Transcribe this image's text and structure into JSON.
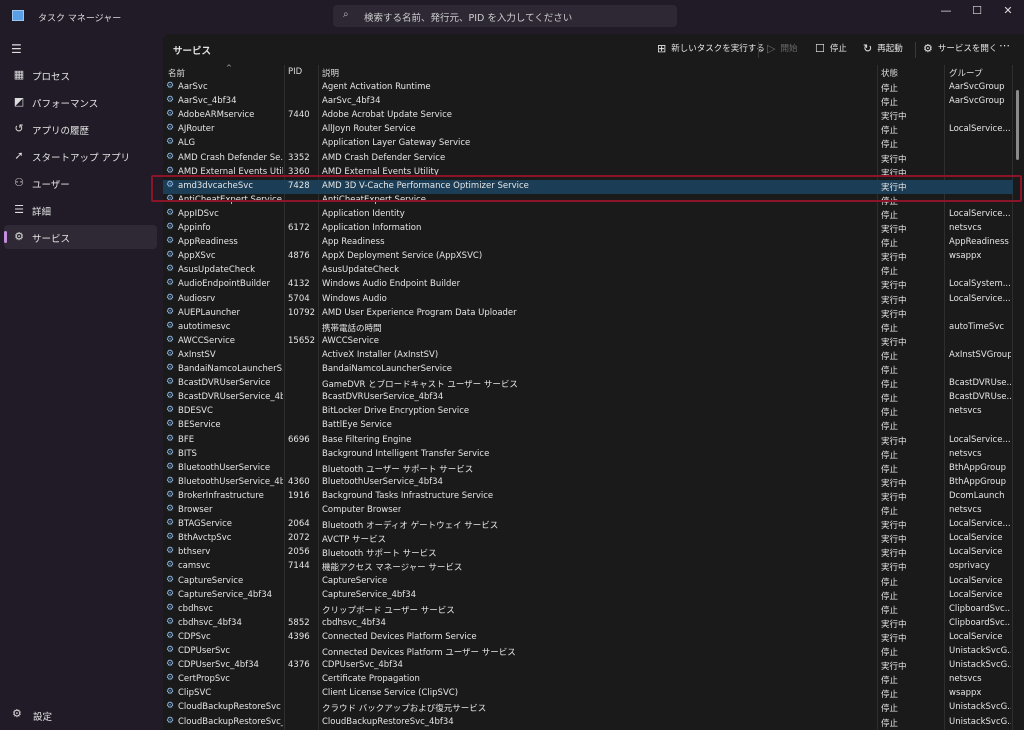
{
  "app": {
    "title": "タスク マネージャー",
    "search_placeholder": "検索する名前、発行元、PID を入力してください"
  },
  "sidebar": {
    "items": [
      {
        "label": "プロセス",
        "icon": "▦"
      },
      {
        "label": "パフォーマンス",
        "icon": "◩"
      },
      {
        "label": "アプリの履歴",
        "icon": "↺"
      },
      {
        "label": "スタートアップ アプリ",
        "icon": "➚"
      },
      {
        "label": "ユーザー",
        "icon": "⚇"
      },
      {
        "label": "詳細",
        "icon": "☰"
      },
      {
        "label": "サービス",
        "icon": "⚙"
      }
    ],
    "settings": "設定"
  },
  "toolbar": {
    "title": "サービス",
    "run_new_task": "新しいタスクを実行する",
    "start": "開始",
    "stop": "停止",
    "restart": "再起動",
    "open_services": "サービスを開く",
    "more": "⋯"
  },
  "columns": {
    "name": "名前",
    "pid": "PID",
    "description": "説明",
    "status": "状態",
    "group": "グループ"
  },
  "selected_index": 7,
  "accent": "#8b1428",
  "rows": [
    [
      "AarSvc",
      "",
      "Agent Activation Runtime",
      "停止",
      "AarSvcGroup"
    ],
    [
      "AarSvc_4bf34",
      "",
      "AarSvc_4bf34",
      "停止",
      "AarSvcGroup"
    ],
    [
      "AdobeARMservice",
      "7440",
      "Adobe Acrobat Update Service",
      "実行中",
      ""
    ],
    [
      "AJRouter",
      "",
      "AllJoyn Router Service",
      "停止",
      "LocalService..."
    ],
    [
      "ALG",
      "",
      "Application Layer Gateway Service",
      "停止",
      ""
    ],
    [
      "AMD Crash Defender Se...",
      "3352",
      "AMD Crash Defender Service",
      "実行中",
      ""
    ],
    [
      "AMD External Events Util...",
      "3360",
      "AMD External Events Utility",
      "実行中",
      ""
    ],
    [
      "amd3dvcacheSvc",
      "7428",
      "AMD 3D V-Cache Performance Optimizer Service",
      "実行中",
      ""
    ],
    [
      "AntiCheatExpert Service",
      "",
      "AntiCheatExpert Service",
      "停止",
      ""
    ],
    [
      "AppIDSvc",
      "",
      "Application Identity",
      "停止",
      "LocalService..."
    ],
    [
      "Appinfo",
      "6172",
      "Application Information",
      "実行中",
      "netsvcs"
    ],
    [
      "AppReadiness",
      "",
      "App Readiness",
      "停止",
      "AppReadiness"
    ],
    [
      "AppXSvc",
      "4876",
      "AppX Deployment Service (AppXSVC)",
      "実行中",
      "wsappx"
    ],
    [
      "AsusUpdateCheck",
      "",
      "AsusUpdateCheck",
      "停止",
      ""
    ],
    [
      "AudioEndpointBuilder",
      "4132",
      "Windows Audio Endpoint Builder",
      "実行中",
      "LocalSystem..."
    ],
    [
      "Audiosrv",
      "5704",
      "Windows Audio",
      "実行中",
      "LocalService..."
    ],
    [
      "AUEPLauncher",
      "10792",
      "AMD User Experience Program Data Uploader",
      "実行中",
      ""
    ],
    [
      "autotimesvc",
      "",
      "携帯電話の時間",
      "停止",
      "autoTimeSvc"
    ],
    [
      "AWCCService",
      "15652",
      "AWCCService",
      "実行中",
      ""
    ],
    [
      "AxInstSV",
      "",
      "ActiveX Installer (AxInstSV)",
      "停止",
      "AxInstSVGroup"
    ],
    [
      "BandaiNamcoLauncherS...",
      "",
      "BandaiNamcoLauncherService",
      "停止",
      ""
    ],
    [
      "BcastDVRUserService",
      "",
      "GameDVR とブロードキャスト ユーザー サービス",
      "停止",
      "BcastDVRUse..."
    ],
    [
      "BcastDVRUserService_4b...",
      "",
      "BcastDVRUserService_4bf34",
      "停止",
      "BcastDVRUse..."
    ],
    [
      "BDESVC",
      "",
      "BitLocker Drive Encryption Service",
      "停止",
      "netsvcs"
    ],
    [
      "BEService",
      "",
      "BattlEye Service",
      "停止",
      ""
    ],
    [
      "BFE",
      "6696",
      "Base Filtering Engine",
      "実行中",
      "LocalService..."
    ],
    [
      "BITS",
      "",
      "Background Intelligent Transfer Service",
      "停止",
      "netsvcs"
    ],
    [
      "BluetoothUserService",
      "",
      "Bluetooth ユーザー サポート サービス",
      "停止",
      "BthAppGroup"
    ],
    [
      "BluetoothUserService_4b...",
      "4360",
      "BluetoothUserService_4bf34",
      "実行中",
      "BthAppGroup"
    ],
    [
      "BrokerInfrastructure",
      "1916",
      "Background Tasks Infrastructure Service",
      "実行中",
      "DcomLaunch"
    ],
    [
      "Browser",
      "",
      "Computer Browser",
      "停止",
      "netsvcs"
    ],
    [
      "BTAGService",
      "2064",
      "Bluetooth オーディオ ゲートウェイ サービス",
      "実行中",
      "LocalService..."
    ],
    [
      "BthAvctpSvc",
      "2072",
      "AVCTP サービス",
      "実行中",
      "LocalService"
    ],
    [
      "bthserv",
      "2056",
      "Bluetooth サポート サービス",
      "実行中",
      "LocalService"
    ],
    [
      "camsvc",
      "7144",
      "機能アクセス マネージャー サービス",
      "実行中",
      "osprivacy"
    ],
    [
      "CaptureService",
      "",
      "CaptureService",
      "停止",
      "LocalService"
    ],
    [
      "CaptureService_4bf34",
      "",
      "CaptureService_4bf34",
      "停止",
      "LocalService"
    ],
    [
      "cbdhsvc",
      "",
      "クリップボード ユーザー サービス",
      "停止",
      "ClipboardSvc..."
    ],
    [
      "cbdhsvc_4bf34",
      "5852",
      "cbdhsvc_4bf34",
      "実行中",
      "ClipboardSvc..."
    ],
    [
      "CDPSvc",
      "4396",
      "Connected Devices Platform Service",
      "実行中",
      "LocalService"
    ],
    [
      "CDPUserSvc",
      "",
      "Connected Devices Platform ユーザー サービス",
      "停止",
      "UnistackSvcG..."
    ],
    [
      "CDPUserSvc_4bf34",
      "4376",
      "CDPUserSvc_4bf34",
      "実行中",
      "UnistackSvcG..."
    ],
    [
      "CertPropSvc",
      "",
      "Certificate Propagation",
      "停止",
      "netsvcs"
    ],
    [
      "ClipSVC",
      "",
      "Client License Service (ClipSVC)",
      "停止",
      "wsappx"
    ],
    [
      "CloudBackupRestoreSvc",
      "",
      "クラウド バックアップおよび復元サービス",
      "停止",
      "UnistackSvcG..."
    ],
    [
      "CloudBackupRestoreSvc_...",
      "",
      "CloudBackupRestoreSvc_4bf34",
      "停止",
      "UnistackSvcG..."
    ]
  ]
}
